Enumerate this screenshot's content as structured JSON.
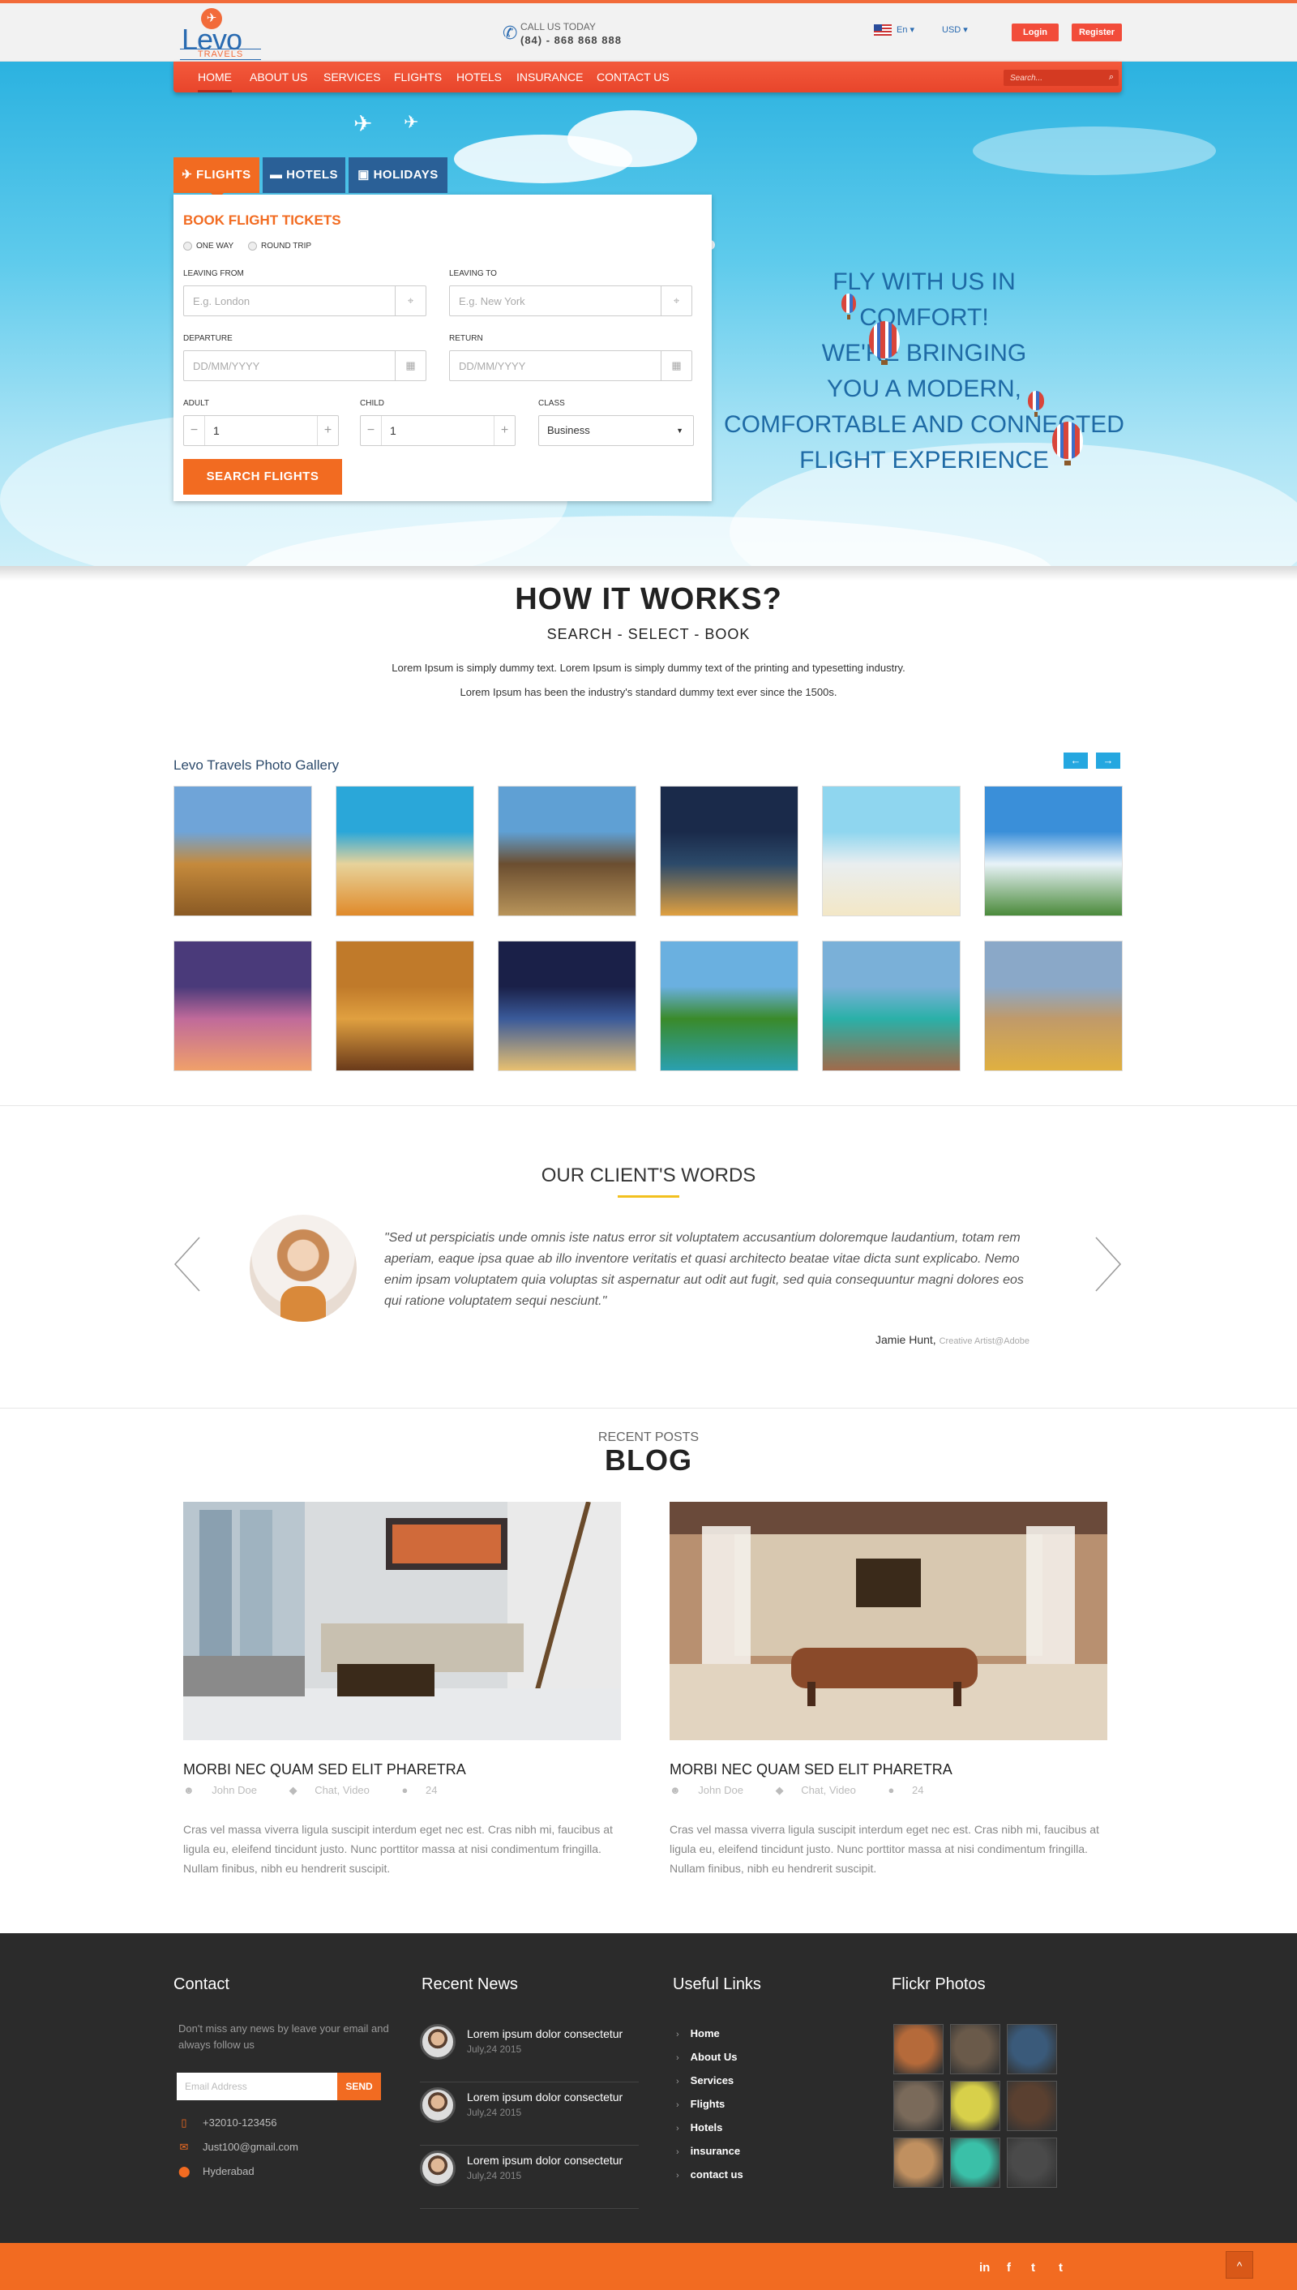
{
  "brand": {
    "logo_word": "Levo",
    "logo_sub": "TRAVELS"
  },
  "topbar": {
    "call_label": "CALL US TODAY",
    "phone": "(84) - 868 868 888",
    "language": "En",
    "currency": "USD",
    "login": "Login",
    "register": "Register"
  },
  "nav": {
    "items": [
      "HOME",
      "ABOUT US",
      "SERVICES",
      "FLIGHTS",
      "HOTELS",
      "INSURANCE",
      "CONTACT US"
    ],
    "active_index": 0,
    "search_placeholder": "Search..."
  },
  "hero": {
    "tagline": "FLY WITH US IN\nCOMFORT!\nWE'RE BRINGING\nYOU A MODERN,\nCOMFORTABLE AND CONNECTED\nFLIGHT EXPERIENCE"
  },
  "booking": {
    "tabs": [
      "FLIGHTS",
      "HOTELS",
      "HOLIDAYS"
    ],
    "title": "BOOK FLIGHT TICKETS",
    "trip_types": [
      "ONE WAY",
      "ROUND TRIP"
    ],
    "leaving_from": {
      "label": "LEAVING FROM",
      "placeholder": "E.g. London"
    },
    "leaving_to": {
      "label": "LEAVING TO",
      "placeholder": "E.g. New York"
    },
    "departure": {
      "label": "DEPARTURE",
      "placeholder": "DD/MM/YYYY"
    },
    "return": {
      "label": "RETURN",
      "placeholder": "DD/MM/YYYY"
    },
    "adult": {
      "label": "ADULT",
      "value": "1"
    },
    "child": {
      "label": "CHILD",
      "value": "1"
    },
    "class": {
      "label": "CLASS",
      "value": "Business"
    },
    "submit": "SEARCH FLIGHTS"
  },
  "how_it_works": {
    "title": "HOW IT WORKS?",
    "subtitle": "SEARCH - SELECT - BOOK",
    "p1": "Lorem Ipsum is simply dummy text. Lorem Ipsum is simply dummy text of the printing and typesetting industry.",
    "p2": "Lorem Ipsum has been the industry's standard dummy text ever since the 1500s."
  },
  "gallery": {
    "title": "Levo Travels Photo Gallery",
    "prev": "←",
    "next": "→",
    "photos": [
      {
        "name": "pyramid-photo",
        "colors": [
          "#6fa4d8",
          "#c58a3c",
          "#8a5a24"
        ]
      },
      {
        "name": "starfish-beach-photo",
        "colors": [
          "#2aa7d9",
          "#e7d39b",
          "#e08a2a"
        ]
      },
      {
        "name": "volcano-photo",
        "colors": [
          "#5fa0d4",
          "#6b4e30",
          "#b8945a"
        ]
      },
      {
        "name": "night-bridge-photo",
        "colors": [
          "#1a2a4a",
          "#2c4a6a",
          "#e0a040"
        ]
      },
      {
        "name": "bottle-beach-photo",
        "colors": [
          "#8fd6ef",
          "#e9eef0",
          "#f3e7c6"
        ]
      },
      {
        "name": "palm-beach-photo",
        "colors": [
          "#3a8fd9",
          "#e8f3f8",
          "#4a8a3a"
        ]
      },
      {
        "name": "venice-photo",
        "colors": [
          "#4a3a7a",
          "#c06a9a",
          "#f0a06a"
        ]
      },
      {
        "name": "city-sunset-photo",
        "colors": [
          "#c07a2a",
          "#e0a040",
          "#6a3a1a"
        ]
      },
      {
        "name": "city-night-photo",
        "colors": [
          "#1a2048",
          "#3a5a9a",
          "#e8c070"
        ]
      },
      {
        "name": "waterfall-photo",
        "colors": [
          "#6ab0e0",
          "#3a8a2a",
          "#2aa0b0"
        ]
      },
      {
        "name": "seychelles-photo",
        "colors": [
          "#7ab0d8",
          "#2ab0a8",
          "#a06a4a"
        ]
      },
      {
        "name": "aerial-city-photo",
        "colors": [
          "#8aa8c8",
          "#c09a6a",
          "#e0b040"
        ]
      }
    ]
  },
  "testimonial": {
    "title": "OUR CLIENT'S WORDS",
    "quote": "\"Sed ut perspiciatis unde omnis iste natus error sit voluptatem accusantium doloremque laudantium, totam rem aperiam, eaque ipsa quae ab illo inventore veritatis et quasi architecto beatae vitae dicta sunt explicabo. Nemo enim ipsam voluptatem quia voluptas sit aspernatur aut odit aut fugit, sed quia consequuntur magni dolores eos qui ratione voluptatem sequi nesciunt.\"",
    "name": "Jamie Hunt,",
    "role": "Creative Artist@Adobe"
  },
  "blog": {
    "kicker": "RECENT POSTS",
    "title": "BLOG",
    "posts": [
      {
        "title": "MORBI NEC QUAM SED ELIT PHARETRA",
        "author": "John Doe",
        "tags": "Chat, Video",
        "comments": "24",
        "excerpt": "Cras vel massa viverra ligula suscipit interdum eget nec est. Cras nibh mi, faucibus at ligula eu, eleifend tincidunt justo. Nunc porttitor massa at nisi condimentum fringilla. Nullam finibus, nibh eu hendrerit suscipit."
      },
      {
        "title": "MORBI NEC QUAM SED ELIT PHARETRA",
        "author": "John Doe",
        "tags": "Chat, Video",
        "comments": "24",
        "excerpt": "Cras vel massa viverra ligula suscipit interdum eget nec est. Cras nibh mi, faucibus at ligula eu, eleifend tincidunt justo. Nunc porttitor massa at nisi condimentum fringilla. Nullam finibus, nibh eu hendrerit suscipit."
      }
    ]
  },
  "footer": {
    "contact": {
      "heading": "Contact",
      "desc": "Don't miss any news by leave your email and always follow us",
      "email_placeholder": "Email Address",
      "send": "SEND",
      "phone": "+32010-123456",
      "email": "Just100@gmail.com",
      "location": "Hyderabad"
    },
    "news": {
      "heading": "Recent News",
      "items": [
        {
          "title": "Lorem ipsum dolor consectetur",
          "date": "July,24 2015"
        },
        {
          "title": "Lorem ipsum dolor consectetur",
          "date": "July,24 2015"
        },
        {
          "title": "Lorem ipsum dolor consectetur",
          "date": "July,24 2015"
        }
      ]
    },
    "links": {
      "heading": "Useful Links",
      "items": [
        "Home",
        "About Us",
        "Services",
        "Flights",
        "Hotels",
        "insurance",
        "contact us"
      ]
    },
    "flickr": {
      "heading": "Flickr Photos",
      "tiles": [
        "#b56a3a",
        "#6a5a4a",
        "#3a5a7a",
        "#7a6a5a",
        "#d8d04a",
        "#5a4030",
        "#c09060",
        "#3ac0a8",
        "#4a4a4a"
      ]
    },
    "social": [
      "in",
      "f",
      "t",
      "t"
    ],
    "to_top": "^"
  },
  "colors": {
    "accent": "#f26b21",
    "nav": "#f24c3a",
    "brand_blue": "#2a6bb1",
    "footer_bg": "#2b2b2b"
  }
}
